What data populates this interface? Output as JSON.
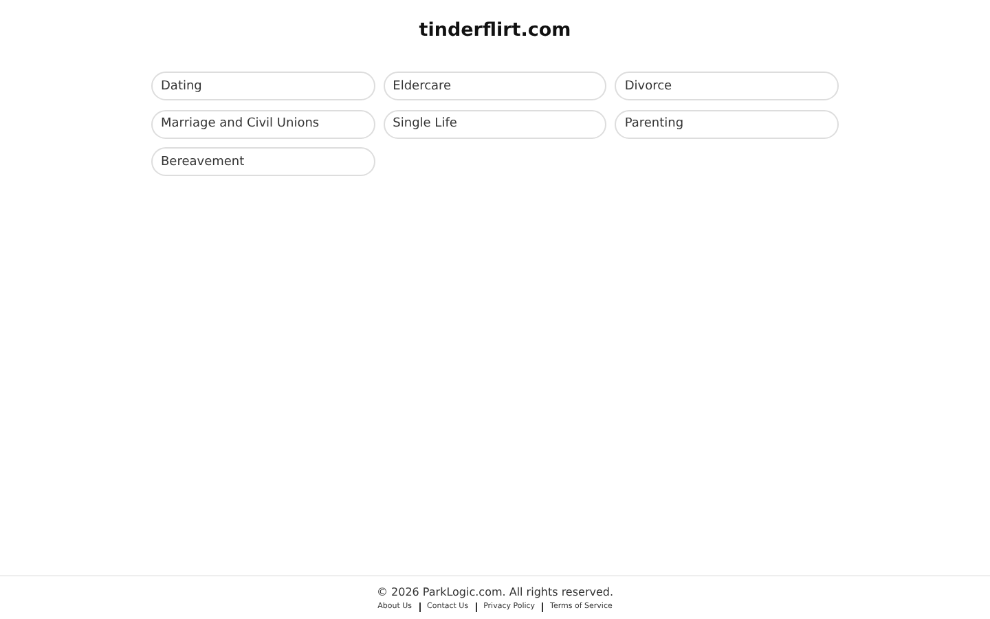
{
  "title": "tinderflirt.com",
  "links": [
    {
      "label": "Dating"
    },
    {
      "label": "Eldercare"
    },
    {
      "label": "Divorce"
    },
    {
      "label": "Marriage and Civil Unions"
    },
    {
      "label": "Single Life"
    },
    {
      "label": "Parenting"
    },
    {
      "label": "Bereavement"
    }
  ],
  "footer": {
    "copyright": "© 2026 ParkLogic.com. All rights reserved.",
    "links": [
      "About Us",
      "Contact Us",
      "Privacy Policy",
      "Terms of Service"
    ]
  }
}
